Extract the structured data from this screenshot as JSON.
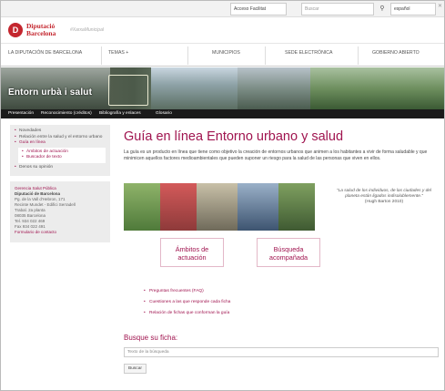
{
  "utility_bar": {
    "accessibility_label": "Acceso Facilitat",
    "search_placeholder": "Buscar",
    "language_value": "español"
  },
  "header": {
    "logo_line1": "Diputació",
    "logo_line2": "Barcelona",
    "hashtag": "#XarxaMunicipal"
  },
  "main_nav": {
    "items": [
      "LA DIPUTACIÓN DE BARCELONA",
      "TEMAS +",
      "MUNICIPIOS",
      "SEDE ELECTRÓNICA",
      "GOBIERNO ABIERTO"
    ]
  },
  "banner": {
    "title": "Entorn urbà i salut"
  },
  "sub_nav": {
    "items": [
      "Presentación",
      "Reconocimiento (créditos)",
      "Bibliografía y enlaces",
      "Glosario"
    ]
  },
  "sidebar": {
    "menu": [
      "Novedades",
      "Relación entre la salud y el entorno urbano",
      "Guía en línea",
      "Ámbitos de actuación",
      "Buscador de texto",
      "Denos su opinión"
    ],
    "contact": [
      "Gerencia Salut Pública",
      "Diputació de Barcelona",
      "Pg. de la Vall d'Hebron, 171",
      "Recinte Mundet - Edifici Serradell",
      "Trabal. 2a planta",
      "08035 Barcelona",
      "Tel. 934 022 469",
      "Fax 934 022 491",
      "Formulario de contacto"
    ]
  },
  "main": {
    "title": "Guía en línea Entorno urbano y salud",
    "intro": "La guía es un producto en línea que tiene como objetivo la creación de entornos urbanos que animen a los habitantes a vivir de forma saludable y que minimicen aquellos factores medioambientales que pueden suponer un riesgo para la salud de las personas que viven en ellos.",
    "quote": "“La salud de los individuos, de las ciudades y del planeta están ligados indisolublemente.”",
    "quote_author": "(Hugh Barton 2010)",
    "button_ambitos": "Ámbitos de actuación",
    "button_busqueda": "Búsqueda acompañada",
    "links": [
      "Preguntas frecuentes (FAQ)",
      "Cuestiones a las que responde cada ficha",
      "Relación de fichas que conforman la guía"
    ],
    "search_label": "Busque su ficha:",
    "search_placeholder": "Texto de la búsqueda",
    "search_button": "Buscar"
  },
  "colors": {
    "accent": "#a0144f",
    "logo_red": "#c4262e",
    "subnav_bg": "#1a1a1a"
  }
}
